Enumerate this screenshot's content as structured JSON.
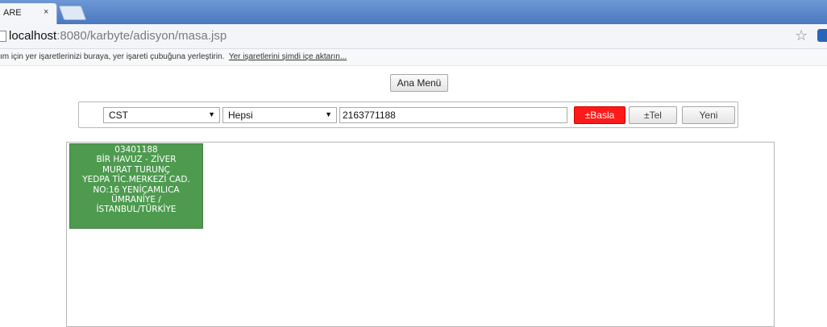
{
  "browser": {
    "tab_title": "ARE",
    "tab_close": "×",
    "url_prefix": "",
    "url_host": "localhost",
    "url_path": ":8080/karbyte/adisyon/masa.jsp",
    "bookmark_message": "ım için yer işaretlerinizi buraya, yer işareti çubuğuna yerleştirin.",
    "bookmark_link": "Yer işaretlerini şimdi içe aktarın...",
    "star_icon": "☆"
  },
  "header": {
    "main_menu_label": "Ana Menü"
  },
  "search": {
    "type_select": {
      "value": "CST",
      "arrow": "▼"
    },
    "filter_select": {
      "value": "Hepsi",
      "arrow": "▼"
    },
    "phone_value": "2163771188",
    "start_label": "±Basla",
    "tel_label": "±Tel",
    "new_label": "Yeni"
  },
  "results": {
    "cards": [
      {
        "lines": [
          "03401188",
          "BİR HAVUZ - ZİVER",
          "MURAT TURUNÇ",
          "YEDPA TİC.MERKEZİ CAD.",
          "NO:16 YENİÇAMLICA",
          "ÜMRANİYE /",
          "İSTANBUL/TÜRKİYE"
        ]
      }
    ]
  },
  "colors": {
    "card_bg": "#4e9b50",
    "start_button_bg": "#ff1a1a",
    "tabstrip": "#4a78bf"
  }
}
